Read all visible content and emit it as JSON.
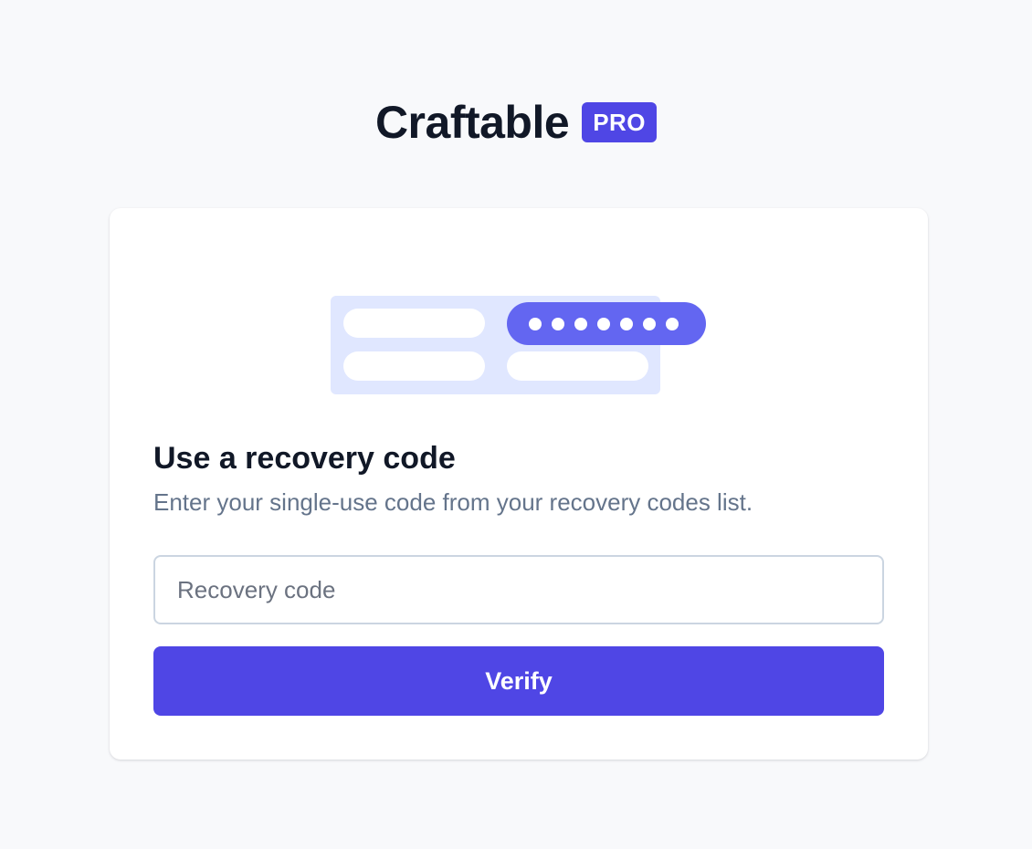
{
  "brand": {
    "name": "Craftable",
    "badge": "PRO",
    "accent_color": "#4f46e5"
  },
  "illustration": {
    "icon": "password-form-illustration",
    "masked_dots": 7,
    "colors": {
      "background": "#e0e7ff",
      "highlight": "#6366f1"
    }
  },
  "card": {
    "title": "Use a recovery code",
    "subtitle": "Enter your single-use code from your recovery codes list.",
    "recovery_input": {
      "placeholder": "Recovery code",
      "value": ""
    },
    "verify_label": "Verify"
  }
}
